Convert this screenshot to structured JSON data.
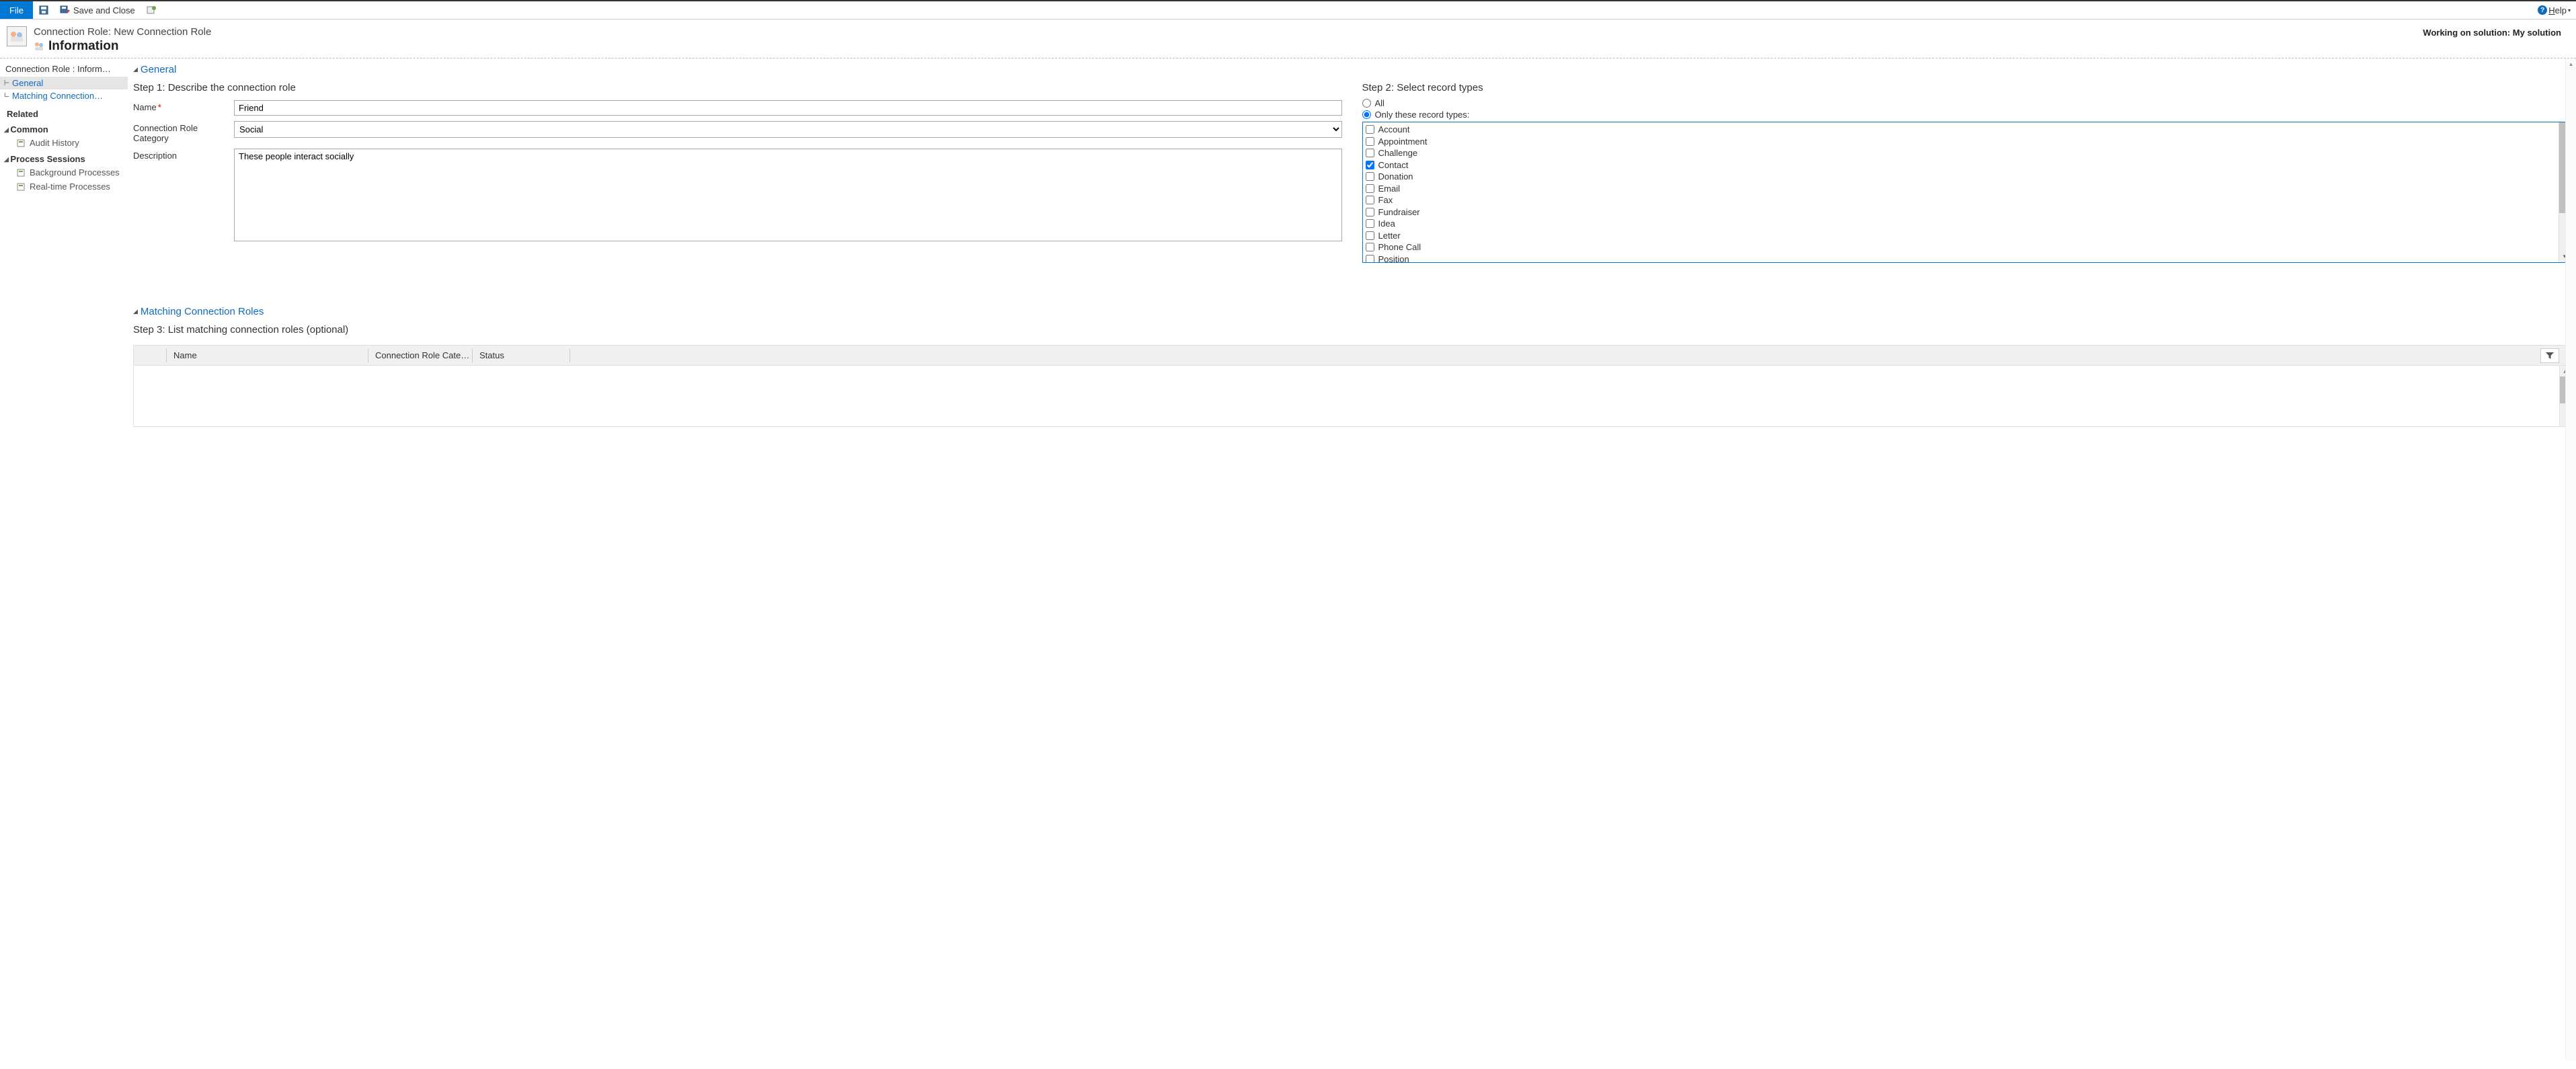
{
  "toolbar": {
    "file": "File",
    "save_close": "Save and Close",
    "help": "Help"
  },
  "header": {
    "breadcrumb": "Connection Role: New Connection Role",
    "title": "Information",
    "solution": "Working on solution: My solution"
  },
  "sidebar": {
    "title": "Connection Role : Inform…",
    "tree": [
      {
        "label": "General",
        "selected": true
      },
      {
        "label": "Matching Connection…",
        "selected": false
      }
    ],
    "related": "Related",
    "groups": [
      {
        "heading": "Common",
        "items": [
          {
            "label": "Audit History"
          }
        ]
      },
      {
        "heading": "Process Sessions",
        "items": [
          {
            "label": "Background Processes"
          },
          {
            "label": "Real-time Processes"
          }
        ]
      }
    ]
  },
  "sections": {
    "general": "General",
    "matching": "Matching Connection Roles"
  },
  "step1": {
    "heading": "Step 1: Describe the connection role",
    "name_label": "Name",
    "name_value": "Friend",
    "category_label": "Connection Role Category",
    "category_value": "Social",
    "description_label": "Description",
    "description_value": "These people interact socially"
  },
  "step2": {
    "heading": "Step 2: Select record types",
    "radio_all": "All",
    "radio_only": "Only these record types:",
    "selected_radio": "only",
    "record_types": [
      {
        "label": "Account",
        "checked": false
      },
      {
        "label": "Appointment",
        "checked": false
      },
      {
        "label": "Challenge",
        "checked": false
      },
      {
        "label": "Contact",
        "checked": true
      },
      {
        "label": "Donation",
        "checked": false
      },
      {
        "label": "Email",
        "checked": false
      },
      {
        "label": "Fax",
        "checked": false
      },
      {
        "label": "Fundraiser",
        "checked": false
      },
      {
        "label": "Idea",
        "checked": false
      },
      {
        "label": "Letter",
        "checked": false
      },
      {
        "label": "Phone Call",
        "checked": false
      },
      {
        "label": "Position",
        "checked": false
      }
    ]
  },
  "step3": {
    "heading": "Step 3: List matching connection roles (optional)",
    "columns": [
      "Name",
      "Connection Role Cate…",
      "Status"
    ]
  }
}
